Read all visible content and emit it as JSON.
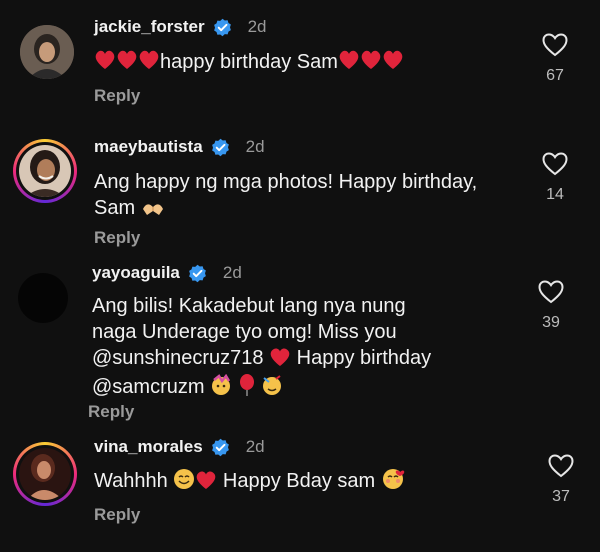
{
  "comments": [
    {
      "username": "jackie_forster",
      "verified": true,
      "time": "2d",
      "text_main": "happy birthday Sam",
      "reply_label": "Reply",
      "like_count": "67",
      "avatar_style": "photo"
    },
    {
      "username": "maeybautista",
      "verified": true,
      "time": "2d",
      "line1": "Ang happy ng mga photos! Happy birthday,",
      "line2": "Sam",
      "reply_label": "Reply",
      "like_count": "14",
      "avatar_style": "story-ring"
    },
    {
      "username": "yayoaguila",
      "verified": true,
      "time": "2d",
      "line1": "Ang bilis! Kakadebut lang nya nung",
      "line2": "naga Underage tyo omg! Miss you",
      "mention1": "@sunshinecruz718",
      "line3_tail": "Happy birthday",
      "mention2": "@samcruzm",
      "reply_label": "Reply",
      "like_count": "39",
      "avatar_style": "dark"
    },
    {
      "username": "vina_morales",
      "verified": true,
      "time": "2d",
      "text_a": "Wahhhh",
      "text_b": "Happy Bday sam",
      "reply_label": "Reply",
      "like_count": "37",
      "avatar_style": "story-ring"
    }
  ],
  "colors": {
    "background": "#101010",
    "verified_badge": "#3897f0",
    "heart_emoji": "#e0243b",
    "muted_text": "#9a9a9a"
  },
  "icons": [
    "verified-badge-icon",
    "heart-outline-icon",
    "red-heart-emoji",
    "smile-emoji",
    "heart-hands-emoji",
    "party-emoji",
    "balloon-emoji",
    "blush-emoji"
  ]
}
